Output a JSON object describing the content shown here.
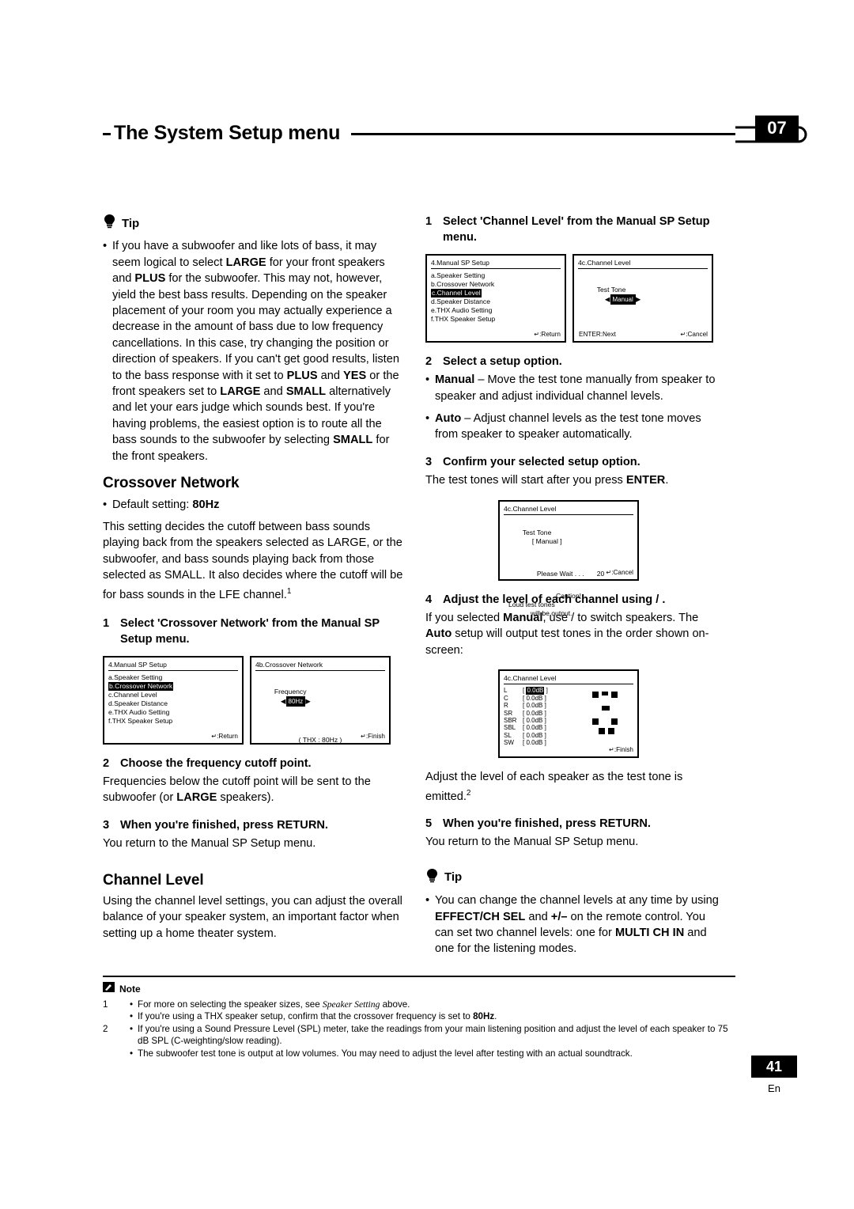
{
  "header": {
    "title": "The System Setup menu",
    "chapter_number": "07"
  },
  "left_column": {
    "tip": {
      "label": "Tip",
      "icon": "lightbulb-icon",
      "body_parts": [
        "If you have a subwoofer and like lots of bass, it may seem logical to select ",
        "LARGE",
        " for your front speakers and ",
        "PLUS",
        " for the subwoofer. This may not, however, yield the best bass results. Depending on the speaker placement of your room you may actually experience a decrease in the amount of bass due to low frequency cancellations. In this case, try changing the position or direction of speakers. If you can't get good results, listen to the bass response with it set to ",
        "PLUS",
        " and ",
        "YES",
        " or the front speakers set to ",
        "LARGE",
        " and ",
        "SMALL",
        " alternatively and let your ears judge which sounds best. If you're having problems, the easiest option is to route all the bass sounds to the subwoofer by selecting ",
        "SMALL",
        " for the front speakers."
      ]
    },
    "crossover": {
      "heading": "Crossover Network",
      "default_bullet_label": "Default setting: ",
      "default_bullet_value": "80Hz",
      "paragraph": "This setting decides the cutoff between bass sounds playing back from the speakers selected as LARGE, or the subwoofer, and bass sounds playing back from those selected as SMALL. It also decides where the cutoff will be for bass sounds in the LFE channel.",
      "paragraph_footnote": "1",
      "step1_num": "1",
      "step1_text": "Select 'Crossover Network' from the Manual SP Setup menu.",
      "step2_num": "2",
      "step2_text": "Choose the frequency cutoff point.",
      "step2_body": "Frequencies below the cutoff point will be sent to the subwoofer (or LARGE speakers).",
      "step3_num": "3",
      "step3_text": "When you're finished, press RETURN.",
      "step3_body": "You return to the Manual SP Setup menu."
    },
    "osd_manual_sp": {
      "title": "4.Manual SP Setup",
      "items": [
        "a.Speaker Setting",
        "b.Crossover Network",
        "c.Channel Level",
        "d.Speaker Distance",
        "e.THX Audio Setting",
        "f.THX Speaker Setup"
      ],
      "highlight_index": 1,
      "footer": "↵:Return"
    },
    "osd_crossover": {
      "title": "4b.Crossover Network",
      "field_label": "Frequency",
      "field_value": "80Hz",
      "thx_line": "( THX : 80Hz )",
      "footer": "↵:Finish"
    },
    "channel_level": {
      "heading": "Channel Level",
      "paragraph": "Using the channel level settings, you can adjust the overall balance of your speaker system, an important factor when setting up a home theater system."
    }
  },
  "right_column": {
    "step1_num": "1",
    "step1_text": "Select 'Channel Level' from the Manual SP Setup menu.",
    "osd_manual_sp": {
      "title": "4.Manual SP Setup",
      "items": [
        "a.Speaker Setting",
        "b.Crossover Network",
        "c.Channel Level",
        "d.Speaker Distance",
        "e.THX Audio Setting",
        "f.THX Speaker Setup"
      ],
      "highlight_index": 2,
      "footer": "↵:Return"
    },
    "osd_channel_level_1": {
      "title": "4c.Channel Level",
      "field_label": "Test Tone",
      "field_value": "Manual",
      "footer_left": "ENTER:Next",
      "footer_right": "↵:Cancel"
    },
    "step2_num": "2",
    "step2_text": "Select a setup option.",
    "bullet_manual_bold": "Manual",
    "bullet_manual_rest": " – Move the test tone manually from speaker to speaker and adjust individual channel levels.",
    "bullet_auto_bold": "Auto",
    "bullet_auto_rest": " – Adjust channel levels as the test tone moves from speaker to speaker automatically.",
    "step3_num": "3",
    "step3_text": "Confirm your selected setup option.",
    "step3_body_pre": "The test tones will start after you press ",
    "step3_body_bold": "ENTER",
    "step3_body_post": ".",
    "osd_channel_level_2": {
      "title": "4c.Channel Level",
      "field_label": "Test Tone",
      "field_value": "[ Manual ]",
      "wait_line": "Please Wait . . .",
      "wait_value": "20",
      "caution_title": "Caution!",
      "caution_line1": "Loud test tones",
      "caution_line2": "will be output.",
      "footer": "↵:Cancel"
    },
    "step4_num": "4",
    "step4_text": "Adjust the level of each channel using  /  .",
    "step4_body_1": "If you selected ",
    "step4_body_manual": "Manual",
    "step4_body_2": ", use  /  to switch speakers. The ",
    "step4_body_auto": "Auto",
    "step4_body_3": " setup will output test tones in the order shown on-screen:",
    "osd_channel_level_3": {
      "title": "4c.Channel Level",
      "rows": [
        {
          "label": "L",
          "value": "0.0dB",
          "selected": true
        },
        {
          "label": "C",
          "value": "0.0dB",
          "selected": false
        },
        {
          "label": "R",
          "value": "0.0dB",
          "selected": false
        },
        {
          "label": "SR",
          "value": "0.0dB",
          "selected": false
        },
        {
          "label": "SBR",
          "value": "0.0dB",
          "selected": false
        },
        {
          "label": "SBL",
          "value": "0.0dB",
          "selected": false
        },
        {
          "label": "SL",
          "value": "0.0dB",
          "selected": false
        },
        {
          "label": "SW",
          "value": "0.0dB",
          "selected": false
        }
      ],
      "footer": "↵:Finish"
    },
    "after_osd_text": "Adjust the level of each speaker as the test tone is emitted.",
    "after_osd_footnote": "2",
    "step5_num": "5",
    "step5_text": "When you're finished, press RETURN.",
    "step5_body": "You return to the Manual SP Setup menu.",
    "tip": {
      "label": "Tip",
      "icon": "lightbulb-icon",
      "body": "You can change the channel levels at any time by using EFFECT/CH SEL and +/– on the remote control. You can set two channel levels: one for MULTI CH IN and one for the listening modes."
    }
  },
  "notes": {
    "label": "Note",
    "icon": "note-icon",
    "items": [
      {
        "marker": "1",
        "bullet": "•",
        "text_pre": "For more on selecting the speaker sizes, see ",
        "text_italic": "Speaker Setting",
        "text_post": " above."
      },
      {
        "marker": "",
        "bullet": "•",
        "text_pre": "If you're using a THX speaker setup, confirm that the crossover frequency is set to ",
        "text_bold": "80Hz",
        "text_post": "."
      },
      {
        "marker": "2",
        "bullet": "•",
        "text_pre": "If you're using a Sound Pressure Level (SPL) meter, take the readings from your main listening position and adjust the level of each speaker to 75 dB SPL (C-weighting/slow reading).",
        "text_post": ""
      },
      {
        "marker": "",
        "bullet": "•",
        "text_pre": "The subwoofer test tone is output at low volumes. You may need to adjust the level after testing with an actual soundtrack.",
        "text_post": ""
      }
    ]
  },
  "footer": {
    "page_number": "41",
    "language": "En"
  }
}
